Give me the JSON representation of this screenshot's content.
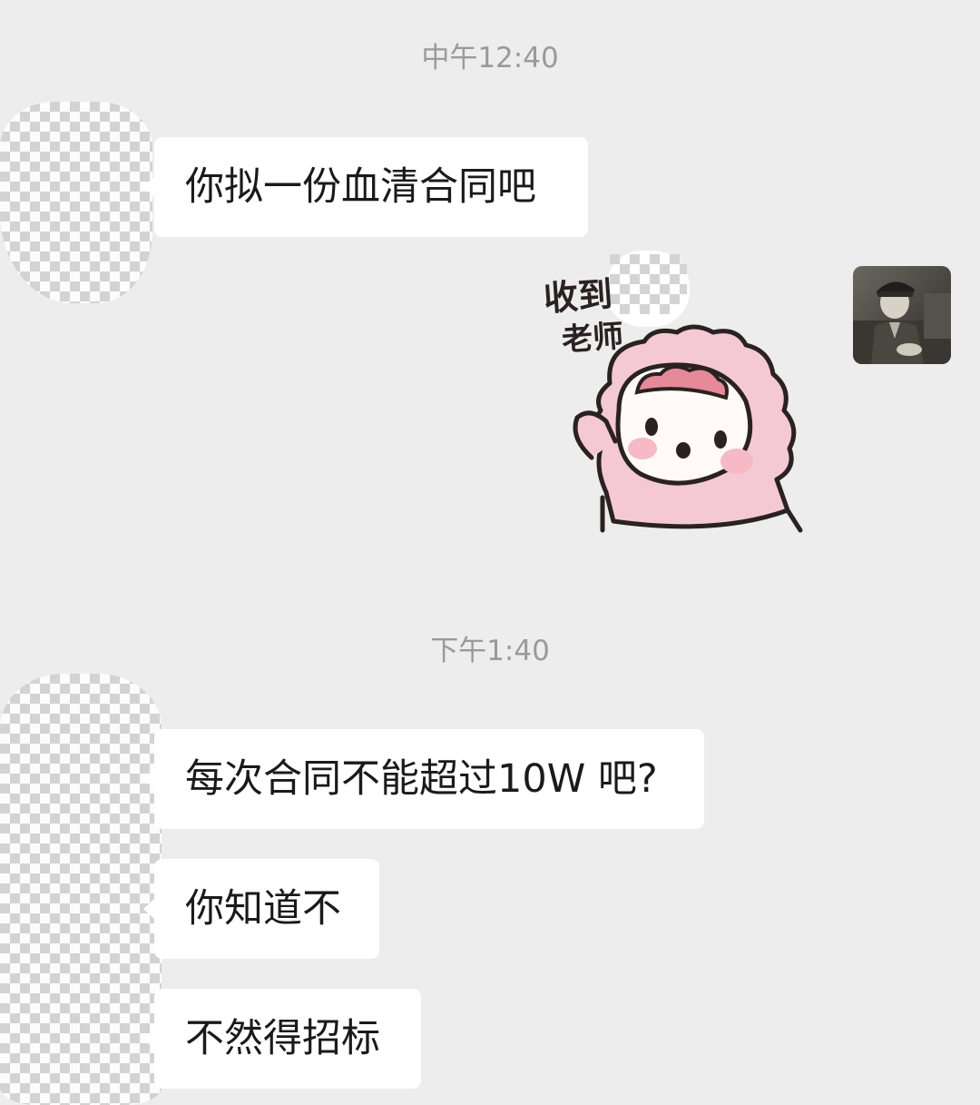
{
  "chat": {
    "timestamps": [
      "中午12:40",
      "下午1:40"
    ],
    "messages": [
      {
        "sender": "other",
        "type": "text",
        "text": "你拟一份血清合同吧"
      },
      {
        "sender": "me",
        "type": "sticker",
        "sticker_text": "收到\n老师",
        "sticker_text_line1": "收到",
        "sticker_text_line2": "老师"
      },
      {
        "sender": "other",
        "type": "text",
        "text": "每次合同不能超过10W 吧?"
      },
      {
        "sender": "other",
        "type": "text",
        "text": "你知道不"
      },
      {
        "sender": "other",
        "type": "text",
        "text": "不然得招标"
      }
    ]
  },
  "colors": {
    "background": "#ededed",
    "bubble": "#ffffff",
    "timestamp_text": "#9a9a9a",
    "sticker_pink": "#f5c9d3"
  }
}
